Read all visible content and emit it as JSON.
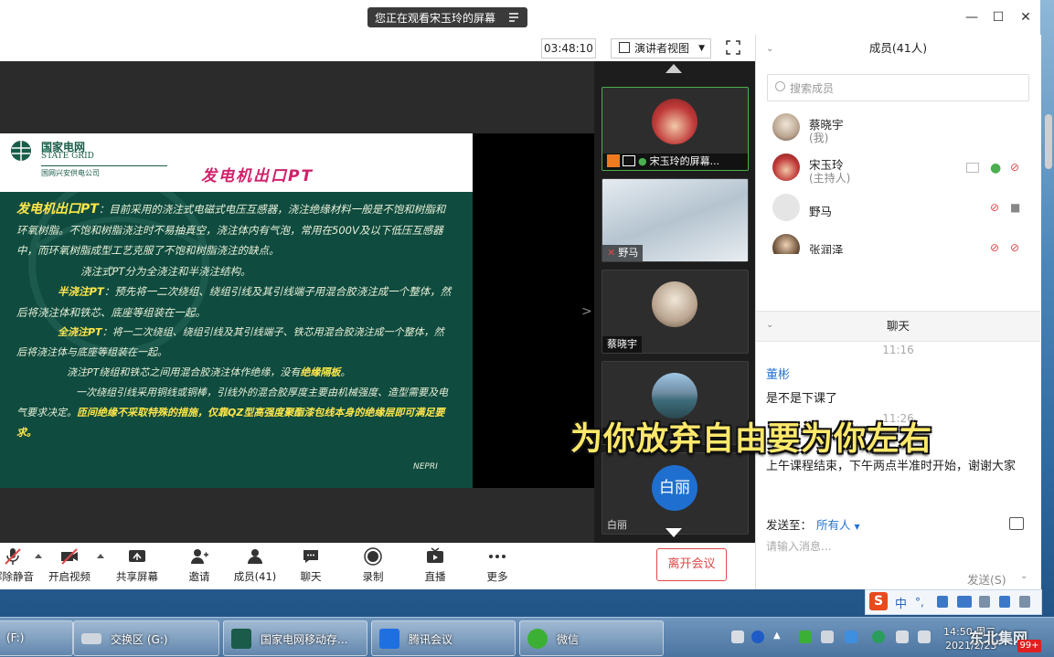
{
  "window": {
    "share_banner": "您正在观看宋玉玲的屏幕",
    "timer": "03:48:10",
    "view_mode": "演讲者视图"
  },
  "slide": {
    "logo_main": "国家电网",
    "logo_sub": "STATE GRID",
    "logo_company": "国网兴安供电公司",
    "title": "发电机出口PT",
    "p1_head": "发电机出口PT",
    "p1_text": "：目前采用的浇注式电磁式电压互感器，浇注绝缘材料一般是不饱和树脂和环氧树脂。不饱和树脂浇注时不易抽真空，浇注体内有气泡，常用在500V及以下低压互感器中，而环氧树脂成型工艺克服了不饱和树脂浇注的缺点。",
    "p2": "浇注式PT分为全浇注和半浇注结构。",
    "p3_head": "半浇注PT",
    "p3_text": "：预先将一二次绕组、绕组引线及其引线端子用混合胶浇注成一个整体，然后将浇注体和铁芯、底座等组装在一起。",
    "p4_head": "全浇注PT",
    "p4_text": "：将一二次绕组、绕组引线及其引线端子、铁芯用混合胶浇注成一个整体，然后将浇注体与底座等组装在一起。",
    "p5_text": "浇注PT绕组和铁芯之间用混合胶浇注体作绝缘，没有",
    "p5_hl": "绝缘隔板",
    "p5_end": "。",
    "p6_text": "一次绕组引线采用铜线或铜棒，引线外的混合胶厚度主要由机械强度、造型需要及电气要求决定。",
    "p6_hl": "匝间绝缘不采取特殊的措施，仅靠QZ型高强度聚酯漆包线本身的绝缘层即可满足要求。",
    "footer": "NEPRI"
  },
  "thumbnails": [
    {
      "name": "宋玉玲的屏幕..."
    },
    {
      "name": "野马"
    },
    {
      "name": "蔡晓宇"
    },
    {
      "name": ""
    },
    {
      "name": "白丽",
      "avatar_text": "白丽"
    }
  ],
  "toolbar": {
    "mute": "解除静音",
    "video": "开启视频",
    "share": "共享屏幕",
    "invite": "邀请",
    "members": "成员(41)",
    "chat": "聊天",
    "record": "录制",
    "live": "直播",
    "more": "更多",
    "leave": "离开会议"
  },
  "members": {
    "header": "成员(41人)",
    "search_placeholder": "搜索成员",
    "list": [
      {
        "name": "蔡晓宇",
        "role": "(我)"
      },
      {
        "name": "宋玉玲",
        "role": "(主持人)"
      },
      {
        "name": "野马",
        "role": ""
      },
      {
        "name": "张润泽",
        "role": ""
      }
    ]
  },
  "chat": {
    "header": "聊天",
    "time1": "11:16",
    "sender1": "董彬",
    "msg1": "是不是下课了",
    "time2": "11:26",
    "msg2": "上午课程结束，下午两点半准时开始，谢谢大家",
    "send_to_label": "发送至：",
    "send_to_target": "所有人",
    "input_placeholder": "请输入消息...",
    "send_button": "发送(S)"
  },
  "subtitle": "为你放弃自由要为你左右",
  "ime": {
    "lang": "中"
  },
  "taskbar": {
    "items": [
      {
        "label": "(F:)"
      },
      {
        "label": "交换区 (G:)"
      },
      {
        "label": "国家电网移动存..."
      },
      {
        "label": "腾讯会议"
      },
      {
        "label": "微信"
      }
    ],
    "time": "14:50 周三",
    "date": "2021/2/23",
    "badge": "99+",
    "watermark": "东北集网"
  },
  "colors": {
    "accent": "#2673d1",
    "leave": "#e0484a",
    "slide_bg": "#0f4b3f",
    "slide_title": "#d0206a",
    "highlight": "#ffe64a",
    "subtitle": "#ffe86a"
  }
}
